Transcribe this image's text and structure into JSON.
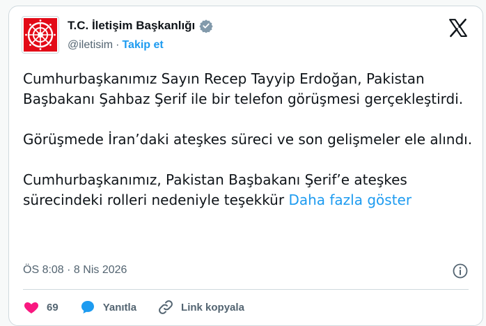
{
  "account": {
    "display_name": "T.C. İletişim Başkanlığı",
    "handle": "@iletisim",
    "separator": "·",
    "follow_label": "Takip et"
  },
  "post": {
    "paragraphs": [
      "Cumhurbaşkanımız Sayın Recep Tayyip Erdoğan, Pakistan Başbakanı Şahbaz Şerif ile bir telefon görüşmesi gerçekleştirdi.",
      "Görüşmede İran’daki ateşkes süreci ve son gelişmeler ele alındı.",
      "Cumhurbaşkanımız, Pakistan Başbakanı Şerif’e ateşkes sürecindeki rolleri nedeniyle teşekkür"
    ],
    "show_more": "Daha fazla göster",
    "timestamp": "ÖS 8:08 · 8 Nis 2026"
  },
  "actions": {
    "like_count": "69",
    "reply_label": "Yanıtla",
    "copy_link_label": "Link kopyala"
  },
  "colors": {
    "accent": "#1d9bf0",
    "like": "#f91880",
    "logo_red": "#e30a17"
  },
  "icons": [
    "verified-badge-icon",
    "x-logo-icon",
    "info-icon",
    "heart-icon",
    "reply-icon",
    "link-icon"
  ]
}
